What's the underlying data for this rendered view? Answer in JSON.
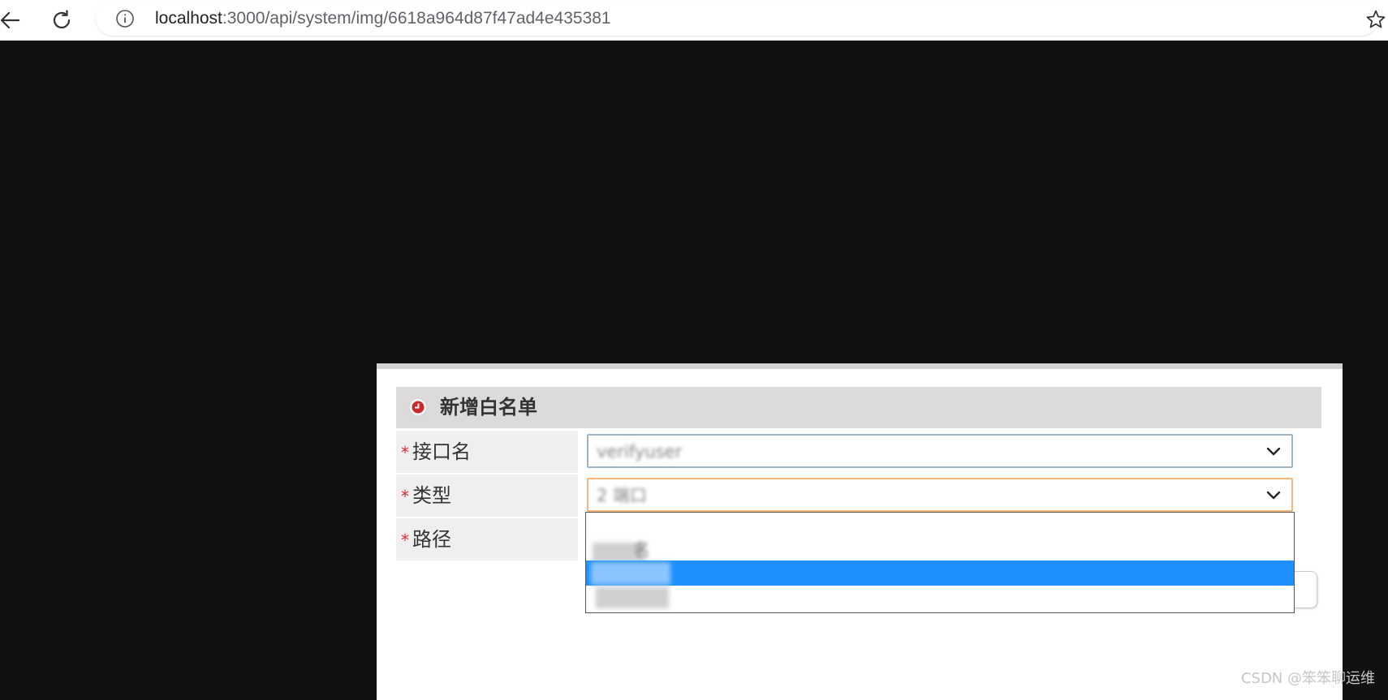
{
  "browser": {
    "back_icon": "arrow-left-icon",
    "reload_icon": "reload-icon",
    "info_icon": "info-icon",
    "bookmark_icon": "star-icon",
    "url_host": "localhost",
    "url_rest": ":3000/api/system/img/6618a964d87f47ad4e435381"
  },
  "form": {
    "title": "新增白名单",
    "required_mark": "*",
    "fields": [
      {
        "label": "接口名",
        "value": "verifyuser"
      },
      {
        "label": "类型",
        "value": "2 端口"
      },
      {
        "label": "路径"
      }
    ]
  },
  "dropdown": {
    "options": [
      {
        "label": ""
      },
      {
        "label": "名"
      },
      {
        "label": "",
        "selected": true
      },
      {
        "label": ""
      }
    ]
  },
  "watermark": "CSDN @笨笨聊运维",
  "colors": {
    "required": "#e3283d",
    "highlight": "#1e90ff",
    "header_bg": "#dcdada",
    "label_bg": "#f0efef"
  }
}
